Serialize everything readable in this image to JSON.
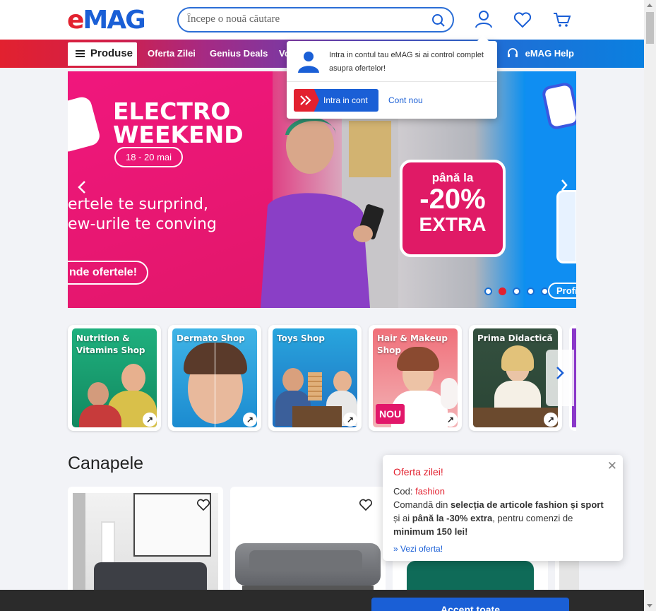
{
  "header": {
    "logo_letters": [
      "e",
      "M",
      "A",
      "G"
    ],
    "logo_colors": [
      "#e2212f",
      "#1a5fd6",
      "#1a5fd6",
      "#1a5fd6"
    ],
    "search_placeholder": "Începe o nouă căutare",
    "icons": [
      "search-icon",
      "user-icon",
      "heart-icon",
      "cart-icon"
    ]
  },
  "nav": {
    "produse": "Produse",
    "links": [
      "Oferta Zilei",
      "Genius Deals",
      "Vo"
    ],
    "help": "eMAG Help"
  },
  "login_popup": {
    "text": "Intra in contul tau eMAG si ai control complet asupra ofertelor!",
    "login_button": "Intra in cont",
    "new_account": "Cont nou"
  },
  "banner": {
    "title_line1": "ELECTRO",
    "title_line2": "WEEKEND",
    "dates": "18 - 20 mai",
    "line1": "ertele te surprind,",
    "line2": "ew-urile te conving",
    "cta": "nde ofertele!",
    "badge_top": "până la",
    "badge_value": "-20%",
    "badge_bottom": "EXTRA",
    "side_label": "Profi",
    "slides": 5,
    "active_slide": 2
  },
  "shops": [
    {
      "label": "Nutrition & Vitamins Shop",
      "color": "#1aa37a",
      "nou": ""
    },
    {
      "label": "Dermato Shop",
      "color": "#35a6d8",
      "nou": ""
    },
    {
      "label": "Toys Shop",
      "color": "#1f9fd6",
      "nou": ""
    },
    {
      "label": "Hair & Makeup Shop",
      "color": "#ef6d78",
      "nou": "NOU"
    },
    {
      "label": "Prima Didactică",
      "color": "#2e4a3a",
      "nou": ""
    }
  ],
  "section": {
    "title": "Canapele"
  },
  "offer": {
    "title": "Oferta zilei!",
    "code_label": "Cod:",
    "code": "fashion",
    "body_1": "Comandă din ",
    "body_2": "selecția de articole fashion și sport",
    "body_3": " și ai ",
    "body_4": "până la -30% extra",
    "body_5": ", pentru comenzi de ",
    "body_6": "minimum 150 lei!",
    "link": "» Vezi oferta!"
  },
  "cookie": {
    "accept": "Accept toate"
  }
}
